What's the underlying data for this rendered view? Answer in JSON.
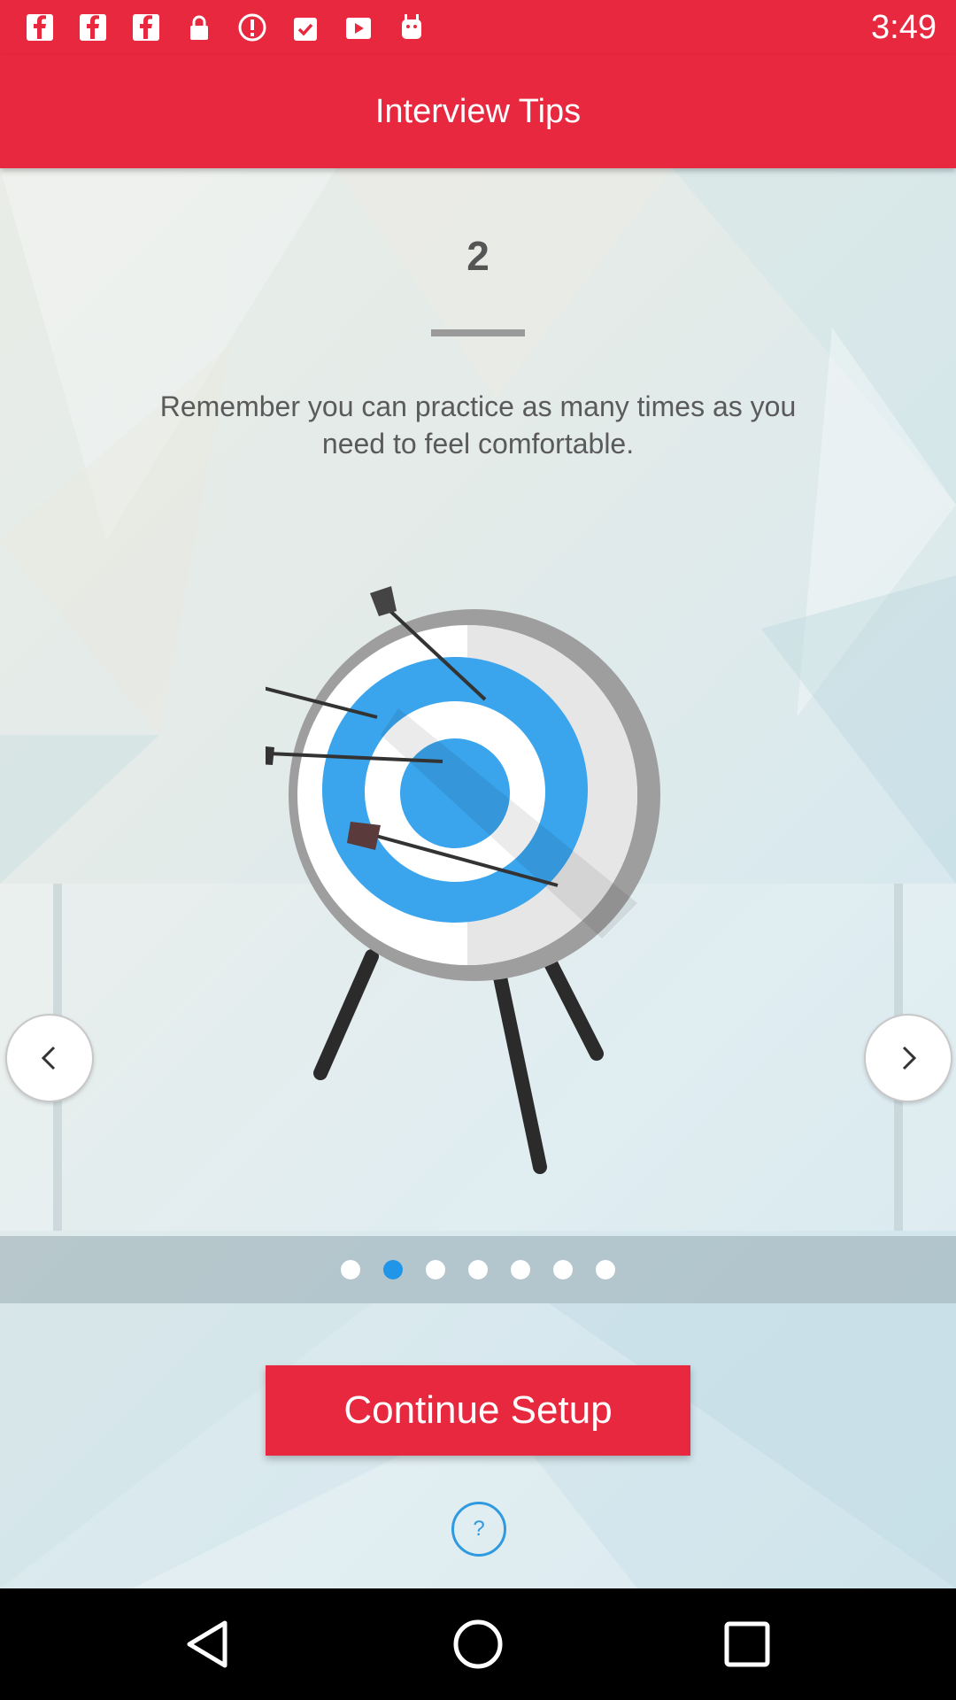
{
  "status_bar": {
    "time": "3:49",
    "icons": [
      "facebook-icon",
      "facebook-icon",
      "facebook-icon",
      "lock-icon",
      "info-icon",
      "clipboard-check-icon",
      "play-store-icon",
      "android-icon"
    ]
  },
  "app_bar": {
    "title": "Interview Tips"
  },
  "tip": {
    "number": "2",
    "text": "Remember you can practice as many times as you need to feel comfortable."
  },
  "pager": {
    "total_pages": 7,
    "current_page": 2
  },
  "actions": {
    "continue_label": "Continue Setup",
    "help_glyph": "?"
  },
  "nav_icons": [
    "back-icon",
    "home-icon",
    "recent-apps-icon"
  ],
  "colors": {
    "accent": "#e8283f",
    "pager_active": "#2196e8",
    "help": "#2f9ae0"
  }
}
